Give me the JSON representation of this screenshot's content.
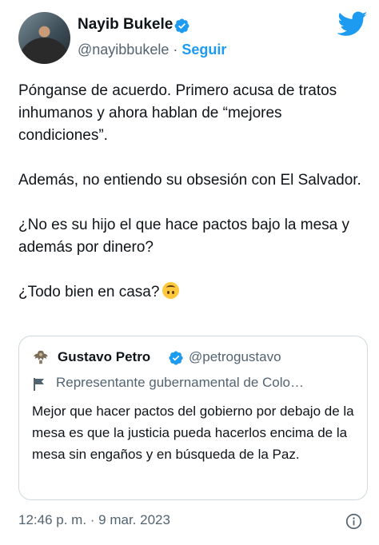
{
  "author": {
    "name": "Nayib Bukele",
    "handle": "@nayibbukele",
    "separator": "·",
    "follow_label": "Seguir",
    "verified_icon": "verified-badge-icon"
  },
  "brand": {
    "logo_icon": "twitter-bird-icon",
    "accent": "#1d9bf0"
  },
  "tweet": {
    "paragraphs": [
      "Pónganse de acuerdo. Primero acusa de tratos inhumanos y ahora hablan de “mejores condiciones”.",
      "Además, no entiendo su obsesión con El Salvador.",
      "¿No es su hijo el que hace pactos bajo la mesa y además por dinero?",
      "¿Todo bien en casa?"
    ],
    "emoji": "upside-down-face"
  },
  "quote": {
    "name": "Gustavo Petro",
    "handle": "@petrogustavo",
    "label": "Representante gubernamental de Colo…",
    "label_icon": "government-flag-icon",
    "text": "Mejor que hacer pactos del gobierno por debajo de la mesa es que la justicia pueda hacerlos encima de la mesa sin engaños y en búsqueda de la Paz."
  },
  "meta": {
    "timestamp": "12:46 p. m. · 9 mar. 2023",
    "info_icon": "info-icon"
  },
  "colors": {
    "text": "#0f1419",
    "secondary": "#536471",
    "border": "#cfd9de",
    "verified": "#1d9bf0"
  }
}
